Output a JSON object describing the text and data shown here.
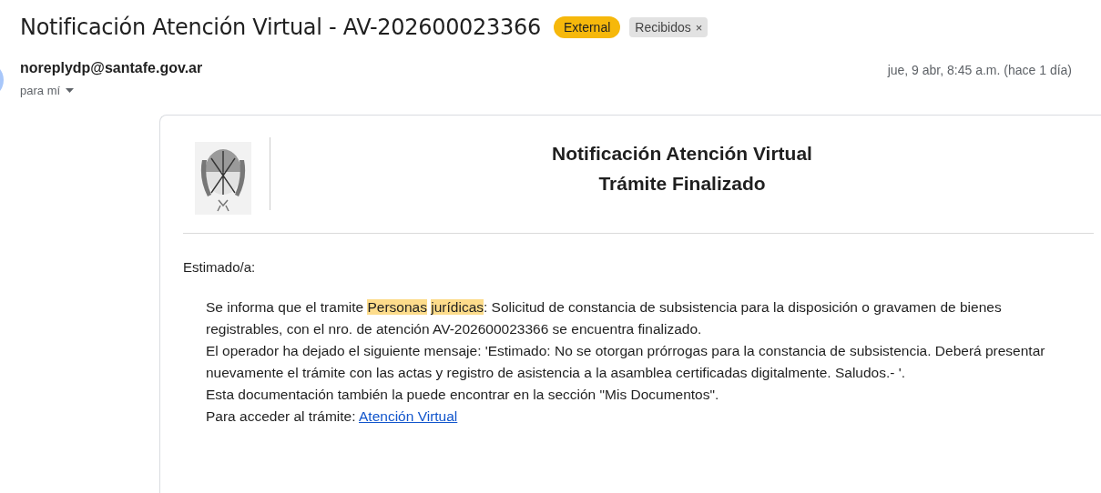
{
  "subject": {
    "title": "Notificación Atención Virtual - AV-202600023366",
    "labels": [
      {
        "text": "External",
        "kind": "warning"
      },
      {
        "text": "Recibidos",
        "kind": "folder",
        "removable": true,
        "remove": "×"
      }
    ]
  },
  "sender": {
    "address": "noreplydp@santafe.gov.ar",
    "recipient": "para mí",
    "date": "jue, 9 abr, 8:45 a.m. (hace 1 día)"
  },
  "message": {
    "heading": [
      "Notificación Atención Virtual",
      "Trámite Finalizado"
    ],
    "greeting": "Estimado/a:",
    "paragraphs": [
      {
        "kind": "highlighted",
        "before": "Se informa que el tramite ",
        "highlights": [
          "Personas",
          "jurídicas"
        ],
        "after": ": Solicitud de constancia de subsistencia para la disposición o gravamen de bienes registrables, con el nro. de atención AV-202600023366 se encuentra finalizado."
      },
      {
        "kind": "plain",
        "text": "El operador ha dejado el siguiente mensaje: 'Estimado: No se otorgan prórrogas para la constancia de subsistencia. Deberá presentar nuevamente el trámite con las actas y registro de asistencia a la asamblea certificadas digitalmente. Saludos.- '."
      },
      {
        "kind": "plain",
        "text": "Esta documentación también la puede encontrar en la sección \"Mis Documentos\"."
      },
      {
        "kind": "link",
        "text": "Para acceder al trámite: ",
        "link": "Atención Virtual"
      }
    ]
  }
}
